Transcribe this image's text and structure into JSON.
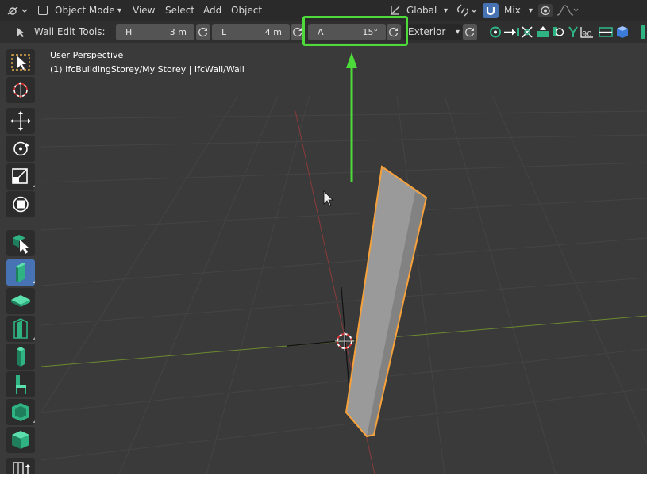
{
  "header": {
    "mode": "Object Mode",
    "menus": [
      "View",
      "Select",
      "Add",
      "Object"
    ],
    "orientation": "Global",
    "shading": "Mix"
  },
  "toolbar": {
    "title": "Wall Edit Tools:",
    "height": {
      "label": "H",
      "value": "3 m"
    },
    "length": {
      "label": "L",
      "value": "4 m"
    },
    "angle": {
      "label": "A",
      "value": "15°"
    },
    "location": "Exterior"
  },
  "viewport": {
    "view_name": "User Perspective",
    "selection_path": "(1) IfcBuildingStorey/My Storey | IfcWall/Wall"
  },
  "colors": {
    "highlight": "#4ddb3a",
    "selection_outline": "#f7a13a",
    "active_tool": "#4772b3",
    "ifc_tool_green": "#2fb383"
  },
  "icons": [
    "editor-type-icon",
    "object-mode-icon",
    "transform-orientation-icon",
    "snap-icon",
    "proportional-edit-icon",
    "select-box-icon",
    "cursor-icon",
    "move-icon",
    "rotate-icon",
    "scale-icon",
    "transform-icon",
    "ifc-explore-icon",
    "wall-tool-icon",
    "slab-tool-icon",
    "door-tool-icon",
    "column-tool-icon",
    "furniture-tool-icon",
    "space-tool-icon",
    "cube-tool-icon",
    "stair-tool-icon"
  ]
}
